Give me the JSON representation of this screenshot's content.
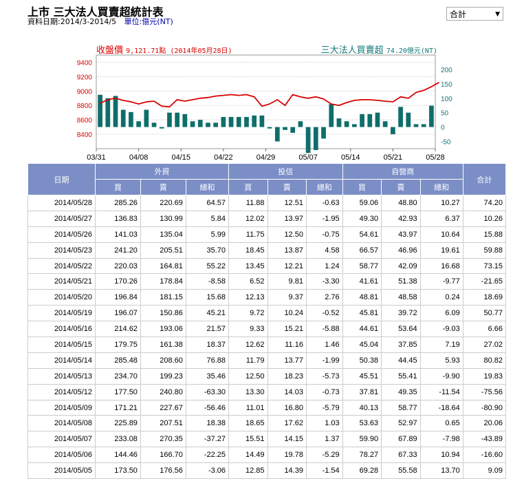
{
  "header": {
    "title": "上市 三大法人買賣超統計表",
    "date_range": "資料日期:2014/3-2014/5",
    "unit": "單位:億元(NT)",
    "select_value": "合計"
  },
  "legend": {
    "left_label": "收盤價",
    "left_value": "9,121.71點 (2014年05月28日)",
    "right_label": "三大法人買賣超",
    "right_value": "74.20億元(NT)"
  },
  "colors": {
    "line": "#d90000",
    "bar": "#0f6e6a",
    "header": "#7b8ec6"
  },
  "chart_data": {
    "type": "bar+line",
    "x_tick_labels": [
      "03/31",
      "04/08",
      "04/15",
      "04/22",
      "04/29",
      "05/07",
      "05/14",
      "05/21",
      "05/28"
    ],
    "y_left_ticks": [
      8400,
      8600,
      8800,
      9000,
      9200,
      9400
    ],
    "y_right_ticks": [
      -50,
      0,
      50,
      100,
      150,
      200
    ],
    "ylim_left": [
      8200,
      9500
    ],
    "ylim_right": [
      -75,
      250
    ],
    "grid": true,
    "bar_values": [
      112,
      100,
      108,
      60,
      52,
      20,
      60,
      15,
      -5,
      50,
      50,
      45,
      20,
      25,
      15,
      15,
      35,
      35,
      35,
      35,
      40,
      40,
      -5,
      -50,
      -10,
      -20,
      20,
      -90,
      -80,
      -40,
      80,
      30,
      20,
      10,
      45,
      45,
      50,
      20,
      -25,
      70,
      50,
      10,
      10,
      74.2
    ],
    "line_values": [
      8830,
      8880,
      8900,
      8870,
      8850,
      8820,
      8850,
      8860,
      8790,
      8780,
      8880,
      8860,
      8880,
      8900,
      8910,
      8930,
      8940,
      8950,
      8940,
      8950,
      8920,
      8790,
      8820,
      8880,
      8800,
      8950,
      8920,
      8900,
      8920,
      8890,
      8820,
      8800,
      8840,
      8870,
      8880,
      8880,
      8870,
      8860,
      8850,
      8920,
      8900,
      8980,
      9010,
      9060,
      9121.71
    ]
  },
  "table": {
    "group_headers": [
      "日期",
      "外資",
      "投信",
      "自營商",
      "合計"
    ],
    "sub_headers": [
      "買",
      "賣",
      "總和",
      "買",
      "賣",
      "總和",
      "買",
      "賣",
      "總和"
    ],
    "rows": [
      [
        "2014/05/28",
        "285.26",
        "220.69",
        "64.57",
        "11.88",
        "12.51",
        "-0.63",
        "59.06",
        "48.80",
        "10.27",
        "74.20"
      ],
      [
        "2014/05/27",
        "136.83",
        "130.99",
        "5.84",
        "12.02",
        "13.97",
        "-1.95",
        "49.30",
        "42.93",
        "6.37",
        "10.26"
      ],
      [
        "2014/05/26",
        "141.03",
        "135.04",
        "5.99",
        "11.75",
        "12.50",
        "-0.75",
        "54.61",
        "43.97",
        "10.64",
        "15.88"
      ],
      [
        "2014/05/23",
        "241.20",
        "205.51",
        "35.70",
        "18.45",
        "13.87",
        "4.58",
        "66.57",
        "46.96",
        "19.61",
        "59.88"
      ],
      [
        "2014/05/22",
        "220.03",
        "164.81",
        "55.22",
        "13.45",
        "12.21",
        "1.24",
        "58.77",
        "42.09",
        "16.68",
        "73.15"
      ],
      [
        "2014/05/21",
        "170.26",
        "178.84",
        "-8.58",
        "6.52",
        "9.81",
        "-3.30",
        "41.61",
        "51.38",
        "-9.77",
        "-21.65"
      ],
      [
        "2014/05/20",
        "196.84",
        "181.15",
        "15.68",
        "12.13",
        "9.37",
        "2.76",
        "48.81",
        "48.58",
        "0.24",
        "18.69"
      ],
      [
        "2014/05/19",
        "196.07",
        "150.86",
        "45.21",
        "9.72",
        "10.24",
        "-0.52",
        "45.81",
        "39.72",
        "6.09",
        "50.77"
      ],
      [
        "2014/05/16",
        "214.62",
        "193.06",
        "21.57",
        "9.33",
        "15.21",
        "-5.88",
        "44.61",
        "53.64",
        "-9.03",
        "6.66"
      ],
      [
        "2014/05/15",
        "179.75",
        "161.38",
        "18.37",
        "12.62",
        "11.16",
        "1.46",
        "45.04",
        "37.85",
        "7.19",
        "27.02"
      ],
      [
        "2014/05/14",
        "285.48",
        "208.60",
        "76.88",
        "11.79",
        "13.77",
        "-1.99",
        "50.38",
        "44.45",
        "5.93",
        "80.82"
      ],
      [
        "2014/05/13",
        "234.70",
        "199.23",
        "35.46",
        "12.50",
        "18.23",
        "-5.73",
        "45.51",
        "55.41",
        "-9.90",
        "19.83"
      ],
      [
        "2014/05/12",
        "177.50",
        "240.80",
        "-63.30",
        "13.30",
        "14.03",
        "-0.73",
        "37.81",
        "49.35",
        "-11.54",
        "-75.56"
      ],
      [
        "2014/05/09",
        "171.21",
        "227.67",
        "-56.46",
        "11.01",
        "16.80",
        "-5.79",
        "40.13",
        "58.77",
        "-18.64",
        "-80.90"
      ],
      [
        "2014/05/08",
        "225.89",
        "207.51",
        "18.38",
        "18.65",
        "17.62",
        "1.03",
        "53.63",
        "52.97",
        "0.65",
        "20.06"
      ],
      [
        "2014/05/07",
        "233.08",
        "270.35",
        "-37.27",
        "15.51",
        "14.15",
        "1.37",
        "59.90",
        "67.89",
        "-7.98",
        "-43.89"
      ],
      [
        "2014/05/06",
        "144.46",
        "166.70",
        "-22.25",
        "14.49",
        "19.78",
        "-5.29",
        "78.27",
        "67.33",
        "10.94",
        "-16.60"
      ],
      [
        "2014/05/05",
        "173.50",
        "176.56",
        "-3.06",
        "12.85",
        "14.39",
        "-1.54",
        "69.28",
        "55.58",
        "13.70",
        "9.09"
      ]
    ]
  }
}
